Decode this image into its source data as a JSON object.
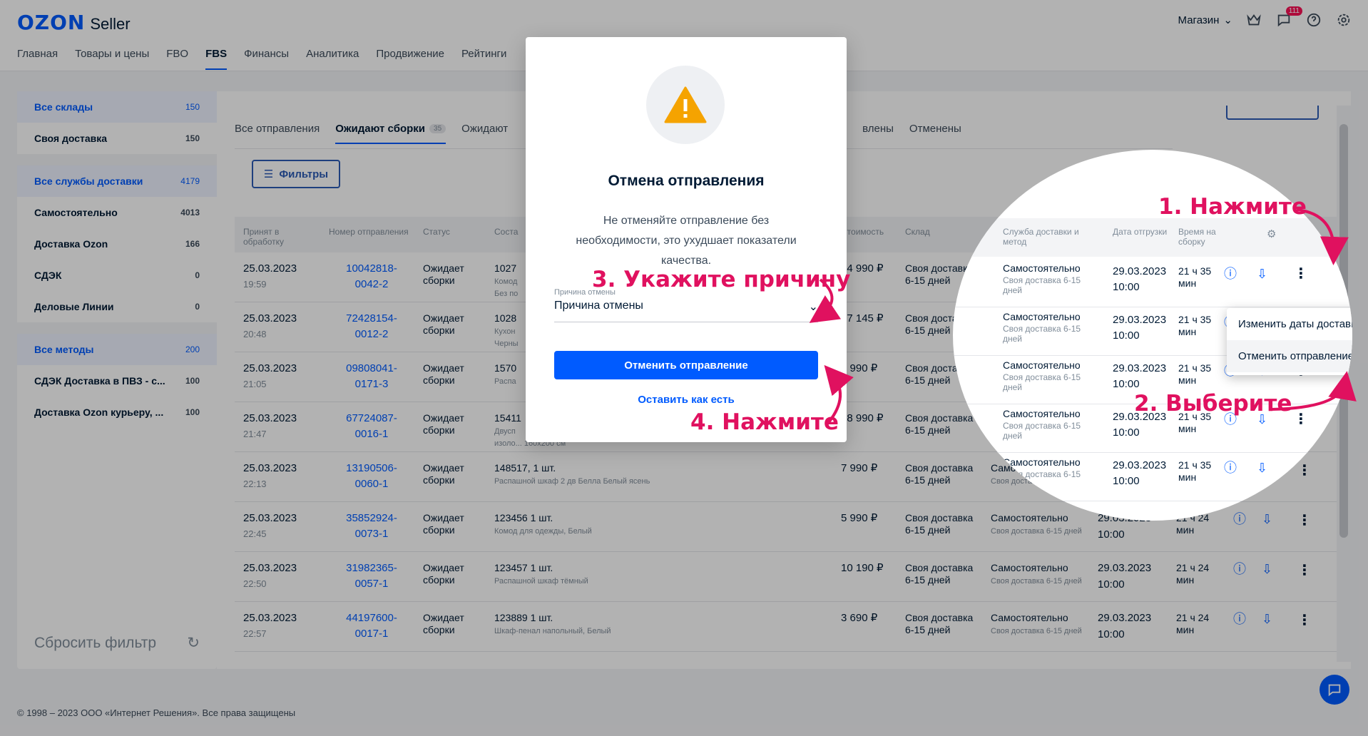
{
  "header": {
    "logo_brand": "OZON",
    "logo_product": "Seller",
    "nav": [
      "Главная",
      "Товары и цены",
      "FBO",
      "FBS",
      "Финансы",
      "Аналитика",
      "Продвижение",
      "Рейтинги"
    ],
    "shop_label": "Магазин",
    "notifications_count": "111"
  },
  "sidebar": {
    "groups": [
      {
        "label": "Все склады",
        "count": "150",
        "items": [
          {
            "label": "Своя доставка",
            "count": "150"
          }
        ]
      },
      {
        "label": "Все службы доставки",
        "count": "4179",
        "items": [
          {
            "label": "Самостоятельно",
            "count": "4013"
          },
          {
            "label": "Доставка Ozon",
            "count": "166"
          },
          {
            "label": "СДЭК",
            "count": "0"
          },
          {
            "label": "Деловые Линии",
            "count": "0"
          }
        ]
      },
      {
        "label": "Все методы",
        "count": "200",
        "items": [
          {
            "label": "СДЭК Доставка в ПВЗ - с...",
            "count": "100"
          },
          {
            "label": "Доставка Ozon курьеру, ...",
            "count": "100"
          }
        ]
      }
    ],
    "reset_label": "Сбросить фильтр"
  },
  "tabs": {
    "all": "Все отправления",
    "awaiting_assembly": "Ожидают сборки",
    "awaiting_assembly_count": "35",
    "awaiting_other": "Ожидают",
    "shipped_partial": "влены",
    "cancelled": "Отменены"
  },
  "filters_label": "Фильтры",
  "table": {
    "headers": {
      "accepted": "Принят в обработку",
      "number": "Номер отправления",
      "status": "Статус",
      "composition": "Соста",
      "cost": "Стоимость",
      "warehouse": "Склад",
      "service": "Служба доставки и метод",
      "ship_date": "Дата отгрузки",
      "assembly_time": "Время на сборку"
    },
    "rows": [
      {
        "date": "25.03.2023",
        "time": "19:59",
        "num1": "10042818-",
        "num2": "0042-2",
        "status": "Ожидает сборки",
        "title": "1027",
        "desc": "Комод",
        "desc2": "Без по",
        "cost": "24 990 ₽",
        "warehouse": "Своя доставка 6-15 дней",
        "service": "Самостоятельно",
        "method": "Своя доставка 6-15 дней",
        "ship_date": "29.03.2023",
        "ship_time": "10:00",
        "remaining": "21 ч 35 мин"
      },
      {
        "date": "25.03.2023",
        "time": "20:48",
        "num1": "72428154-",
        "num2": "0012-2",
        "status": "Ожидает сборки",
        "title": "1028",
        "desc": "Кухон",
        "desc2": "Черны",
        "cost": "17 145 ₽",
        "warehouse": "Своя доставка 6-15 дней",
        "service": "Самостоятельно",
        "method": "Своя доставка 6-15 дней",
        "ship_date": "29.03.2023",
        "ship_time": "10:00",
        "remaining": "21 ч 35 мин"
      },
      {
        "date": "25.03.2023",
        "time": "21:05",
        "num1": "09808041-",
        "num2": "0171-3",
        "status": "Ожидает сборки",
        "title": "1570",
        "desc": "Распа",
        "desc2": "",
        "cost": "9 990 ₽",
        "warehouse": "Своя доставка 6-15 дней",
        "service": "Самостоятельно",
        "method": "Своя доставка 6-15 дней",
        "ship_date": "29.03.2023",
        "ship_time": "10:00",
        "remaining": "21 ч 35 мин"
      },
      {
        "date": "25.03.2023",
        "time": "21:47",
        "num1": "67724087-",
        "num2": "0016-1",
        "status": "Ожидает сборки",
        "title": "15411",
        "desc": "Двусп",
        "desc2": "изоло... 160x200 см",
        "cost": "28 990 ₽",
        "warehouse": "Своя доставка 6-15 дней",
        "service": "Самостоятельно",
        "method": "Своя доставка 6-15 дней",
        "ship_date": "29.03.2023",
        "ship_time": "10:00",
        "remaining": "21 ч 35 мин"
      },
      {
        "date": "25.03.2023",
        "time": "22:13",
        "num1": "13190506-",
        "num2": "0060-1",
        "status": "Ожидает сборки",
        "title": "148517, 1 шт.",
        "desc": "Распашной шкаф 2 дв Белла Белый ясень",
        "desc2": "",
        "cost": "7 990 ₽",
        "warehouse": "Своя доставка 6-15 дней",
        "service": "Самостоятельно",
        "method": "Своя доставка 6-15 дней",
        "ship_date": "29.03.2023",
        "ship_time": "10:00",
        "remaining": "21 ч 35 мин"
      },
      {
        "date": "25.03.2023",
        "time": "22:45",
        "num1": "35852924-",
        "num2": "0073-1",
        "status": "Ожидает сборки",
        "title": "123456 1 шт.",
        "desc": "Комод для одежды, Белый",
        "desc2": "",
        "cost": "5 990 ₽",
        "warehouse": "Своя доставка 6-15 дней",
        "service": "Самостоятельно",
        "method": "Своя доставка 6-15 дней",
        "ship_date": "29.03.2023",
        "ship_time": "10:00",
        "remaining": "21 ч 24 мин"
      },
      {
        "date": "25.03.2023",
        "time": "22:50",
        "num1": "31982365-",
        "num2": "0057-1",
        "status": "Ожидает сборки",
        "title": "123457 1 шт.",
        "desc": "Распашной шкаф тёмный",
        "desc2": "",
        "cost": "10 190 ₽",
        "warehouse": "Своя доставка 6-15 дней",
        "service": "Самостоятельно",
        "method": "Своя доставка 6-15 дней",
        "ship_date": "29.03.2023",
        "ship_time": "10:00",
        "remaining": "21 ч 24 мин"
      },
      {
        "date": "25.03.2023",
        "time": "22:57",
        "num1": "44197600-",
        "num2": "0017-1",
        "status": "Ожидает сборки",
        "title": "123889 1 шт.",
        "desc": "Шкаф-пенал напольный, Белый",
        "desc2": "",
        "cost": "3 690 ₽",
        "warehouse": "Своя доставка 6-15 дней",
        "service": "Самостоятельно",
        "method": "Своя доставка 6-15 дней",
        "ship_date": "29.03.2023",
        "ship_time": "10:00",
        "remaining": "21 ч 24 мин"
      }
    ]
  },
  "dropdown": {
    "change_dates": "Изменить даты доставки",
    "cancel": "Отменить отправление"
  },
  "modal": {
    "title": "Отмена отправления",
    "text": "Не отменяйте отправление без необходимости, это ухудшает показатели качества.",
    "reason_label": "Причина отмены",
    "reason_value": "Причина отмены",
    "confirm_label": "Отменить отправление",
    "keep_label": "Оставить как есть"
  },
  "annotations": {
    "step1": "1. Нажмите",
    "step2": "2. Выберите",
    "step3": "3. Укажите причину",
    "step4": "4. Нажмите",
    "color": "#e0115f"
  },
  "footer": "© 1998 – 2023 ООО «Интернет Решения». Все права защищены",
  "colors": {
    "accent": "#005bff",
    "annotation": "#e0115f",
    "warning": "#f5a300"
  }
}
